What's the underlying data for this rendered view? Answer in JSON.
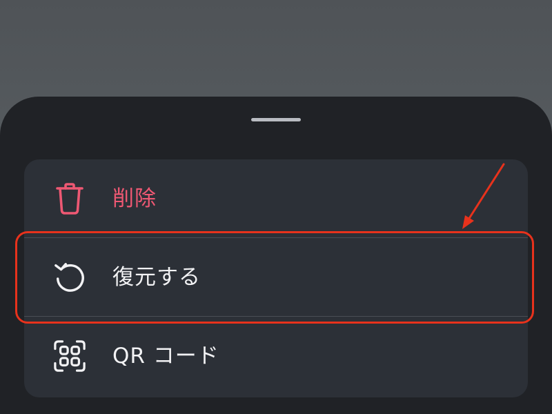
{
  "sheet": {
    "items": [
      {
        "label": "削除",
        "icon": "trash-icon",
        "color": "#ee5873"
      },
      {
        "label": "復元する",
        "icon": "restore-icon",
        "color": "#f2f2f4"
      },
      {
        "label": "QR コード",
        "icon": "qr-code-icon",
        "color": "#f2f2f4"
      }
    ]
  },
  "annotation": {
    "highlight_color": "#e8321c",
    "highlighted_item": "復元する"
  }
}
